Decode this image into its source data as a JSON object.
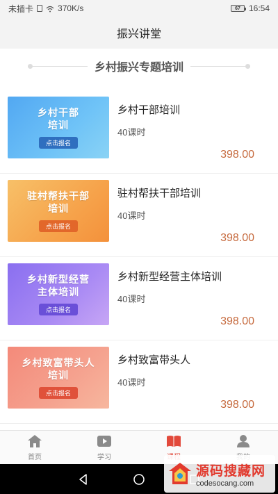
{
  "status_bar": {
    "carrier": "未插卡",
    "speed": "370K/s",
    "battery": "67",
    "time": "16:54"
  },
  "header": {
    "title": "振兴讲堂"
  },
  "section": {
    "title": "乡村振兴专题培训"
  },
  "courses": [
    {
      "thumb_text": "乡村干部\n培训",
      "thumb_button": "点击报名",
      "theme": "blue",
      "name": "乡村干部培训",
      "hours": "40课时",
      "price": "398.00"
    },
    {
      "thumb_text": "驻村帮扶干部\n培训",
      "thumb_button": "点击报名",
      "theme": "orange",
      "name": "驻村帮扶干部培训",
      "hours": "40课时",
      "price": "398.00"
    },
    {
      "thumb_text": "乡村新型经营\n主体培训",
      "thumb_button": "点击报名",
      "theme": "purple",
      "name": "乡村新型经营主体培训",
      "hours": "40课时",
      "price": "398.00"
    },
    {
      "thumb_text": "乡村致富带头人\n培训",
      "thumb_button": "点击报名",
      "theme": "red",
      "name": "乡村致富带头人",
      "hours": "40课时",
      "price": "398.00"
    }
  ],
  "tabs": [
    {
      "label": "首页",
      "icon": "home-icon",
      "active": false
    },
    {
      "label": "学习",
      "icon": "play-icon",
      "active": false
    },
    {
      "label": "课程",
      "icon": "book-icon",
      "active": true
    },
    {
      "label": "我的",
      "icon": "user-icon",
      "active": false
    }
  ],
  "colors": {
    "price": "#c66a3e",
    "active_tab": "#e2493b",
    "inactive_tab": "#888888"
  },
  "watermark": {
    "main": "源码搜藏网",
    "sub": "codesocang.com"
  }
}
